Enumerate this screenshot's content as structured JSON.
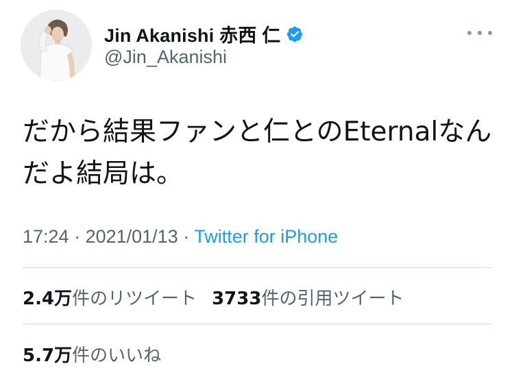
{
  "user": {
    "display_name": "Jin Akanishi  赤西 仁",
    "handle": "@Jin_Akanishi",
    "verified": true
  },
  "icons": {
    "avatar": "profile-photo",
    "verified": "verified-badge-icon",
    "more": "more-options-icon"
  },
  "tweet": {
    "text": "だから結果ファンと仁とのEternalなんだよ結局は。",
    "time": "17:24",
    "separator": " · ",
    "date": "2021/01/13",
    "source": "Twitter for iPhone"
  },
  "stats": {
    "retweets_count": "2.4万",
    "retweets_label": "件のリツイート",
    "quotes_count": "3733",
    "quotes_label": "件の引用ツイート",
    "likes_count": "5.7万",
    "likes_label": "件のいいね"
  },
  "colors": {
    "link": "#1d9bf0",
    "verified": "#1d9bf0",
    "muted": "#536471",
    "divider": "#cfd9de"
  }
}
